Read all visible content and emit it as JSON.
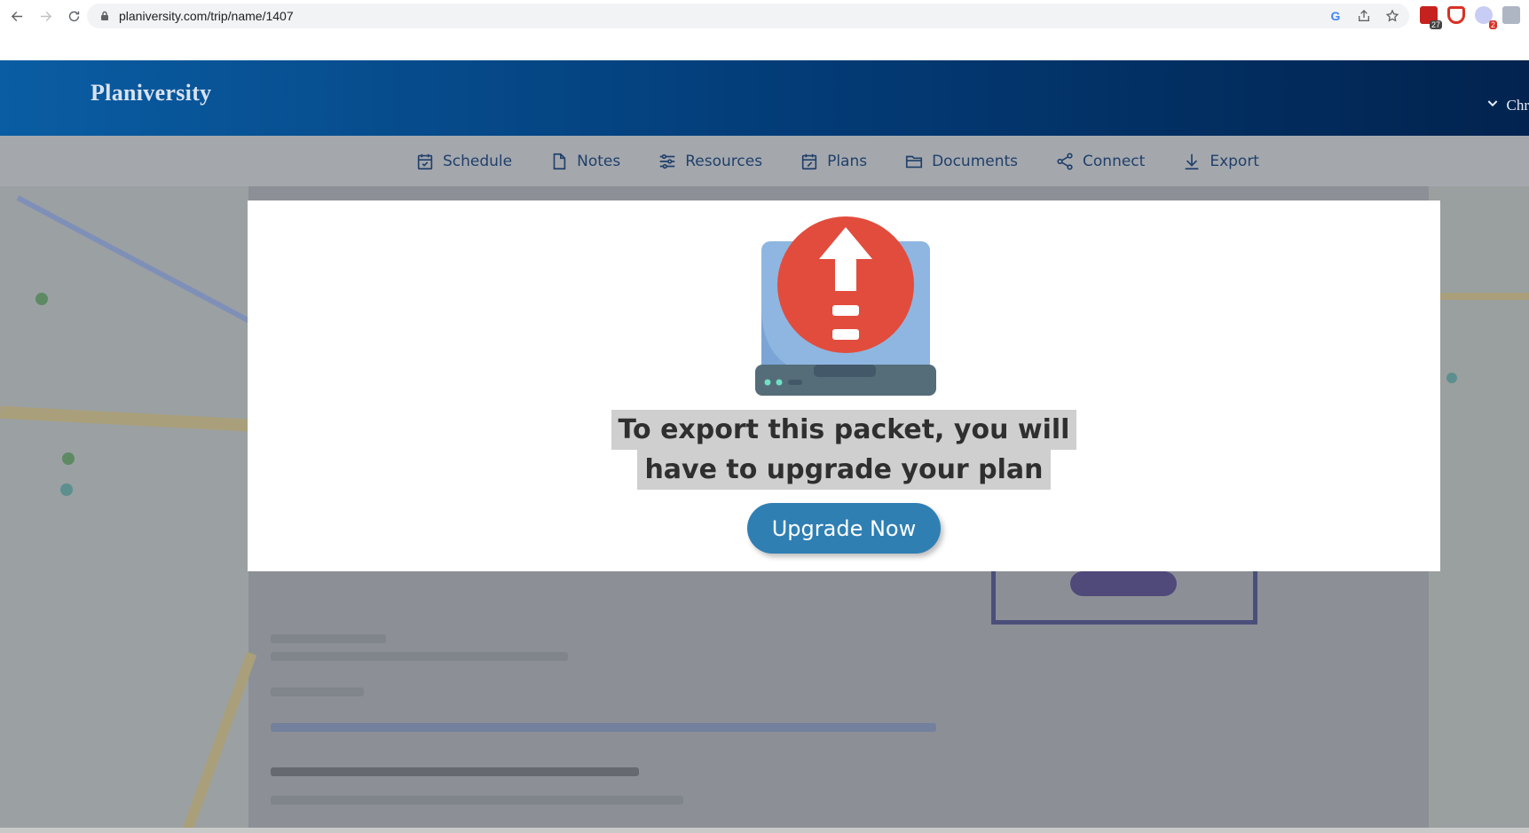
{
  "browser": {
    "url": "planiversity.com/trip/name/1407",
    "extensions": [
      {
        "name": "calendar-extension-icon",
        "badge": "27",
        "color": "#c5221f"
      },
      {
        "name": "pocket-extension-icon",
        "badge": "",
        "color": "#d93025"
      },
      {
        "name": "puzzle-extension-icon",
        "badge": "2",
        "color": "#3f51b5"
      },
      {
        "name": "js-extension-icon",
        "badge": "",
        "color": "#9aa4b5"
      }
    ]
  },
  "header": {
    "brand": "Planiversity",
    "user_label": "Chr"
  },
  "tabs": [
    {
      "label": "Schedule",
      "icon": "calendar-check-icon"
    },
    {
      "label": "Notes",
      "icon": "document-icon"
    },
    {
      "label": "Resources",
      "icon": "sliders-icon"
    },
    {
      "label": "Plans",
      "icon": "calendar-edit-icon"
    },
    {
      "label": "Documents",
      "icon": "folder-icon"
    },
    {
      "label": "Connect",
      "icon": "share-icon"
    },
    {
      "label": "Export",
      "icon": "download-icon"
    }
  ],
  "modal": {
    "message_line1": "To export this packet, you will",
    "message_line2": "have to upgrade your plan",
    "button_label": "Upgrade Now",
    "icon": "upload-alert-icon",
    "colors": {
      "alert_red": "#e24c3d",
      "screen_blue": "#8fb6e0",
      "base_gray": "#546d79",
      "button_blue": "#2f7fb3"
    }
  }
}
